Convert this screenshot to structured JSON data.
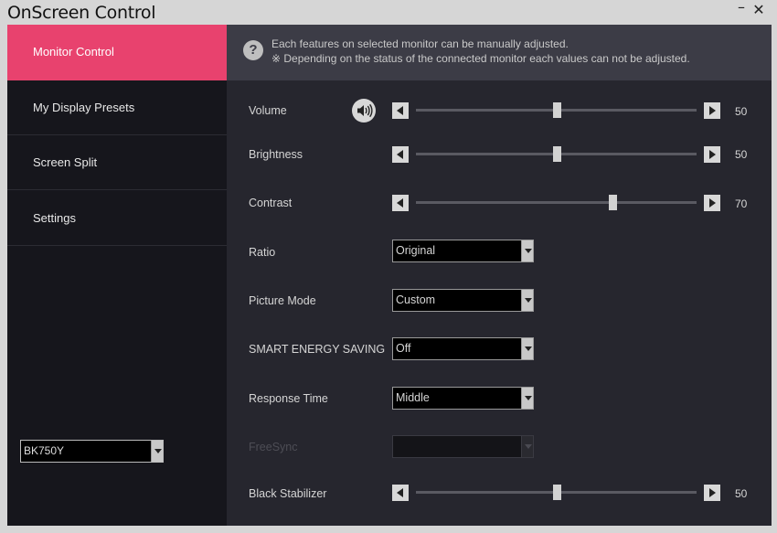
{
  "window": {
    "title": "OnScreen Control",
    "minimize": "–",
    "close": "✕"
  },
  "sidebar": {
    "items": [
      {
        "label": "Monitor Control"
      },
      {
        "label": "My Display Presets"
      },
      {
        "label": "Screen Split"
      },
      {
        "label": "Settings"
      }
    ],
    "active_index": 0,
    "monitor_select": {
      "value": "BK750Y"
    }
  },
  "info": {
    "icon": "?",
    "line1": "Each features on selected monitor can be manually adjusted.",
    "line2": "※ Depending on the status of the connected monitor each values can not be adjusted."
  },
  "controls": {
    "volume": {
      "label": "Volume",
      "value": "50"
    },
    "brightness": {
      "label": "Brightness",
      "value": "50"
    },
    "contrast": {
      "label": "Contrast",
      "value": "70"
    },
    "ratio": {
      "label": "Ratio",
      "value": "Original"
    },
    "picture_mode": {
      "label": "Picture Mode",
      "value": "Custom"
    },
    "smart_energy": {
      "label": "SMART ENERGY SAVING",
      "value": "Off"
    },
    "response_time": {
      "label": "Response Time",
      "value": "Middle"
    },
    "freesync": {
      "label": "FreeSync",
      "value": "",
      "disabled": true
    },
    "black_stabilizer": {
      "label": "Black Stabilizer",
      "value": "50"
    }
  },
  "colors": {
    "accent": "#e8426e",
    "sidebar_bg": "#16161c",
    "main_bg": "#26262e",
    "info_bg": "#3c3c46"
  },
  "icons": {
    "volume": "speaker-icon",
    "info": "question-mark-icon"
  }
}
